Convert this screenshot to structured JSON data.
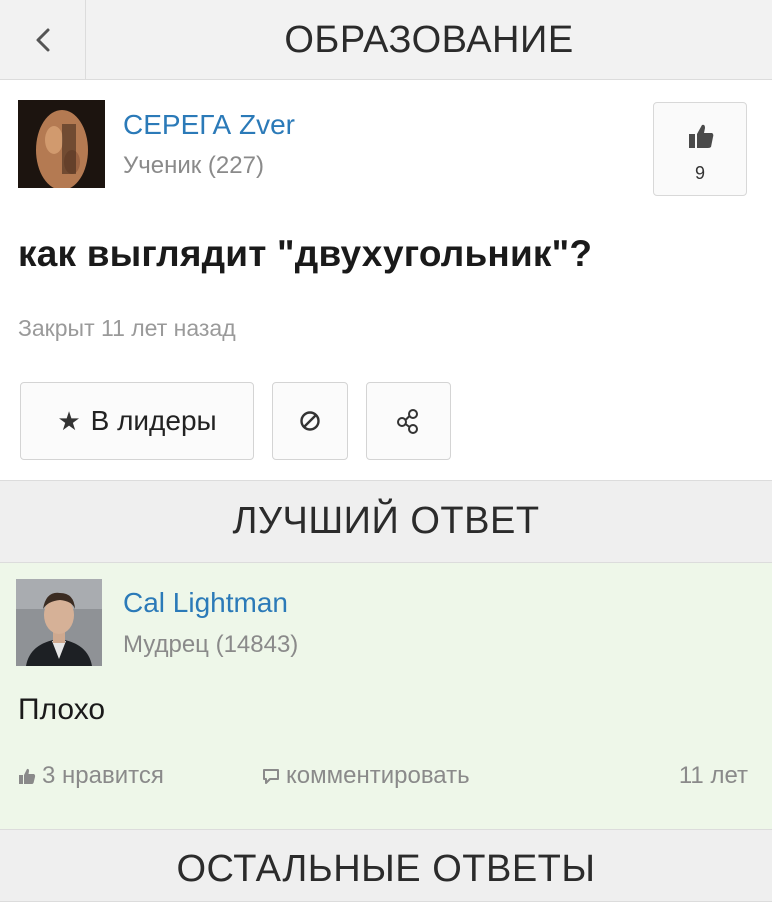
{
  "header": {
    "title": "ОБРАЗОВАНИЕ",
    "back_icon": "chevron-left-icon"
  },
  "question": {
    "author": {
      "name": "СЕРЕГА Zver",
      "rank": "Ученик (227)"
    },
    "like": {
      "icon": "thumbs-up-icon",
      "count": "9"
    },
    "title": "как выглядит \"двухугольник\"?",
    "status": "Закрыт 11 лет назад",
    "actions": {
      "leaders_icon": "star-icon",
      "leaders_label": "В лидеры",
      "report_icon": "block-icon",
      "share_icon": "share-icon"
    }
  },
  "best_answer": {
    "section_title": "ЛУЧШИЙ ОТВЕТ",
    "author": {
      "name": "Cal Lightman",
      "rank": "Мудрец (14843)"
    },
    "text": "Плохо",
    "likes_label": "3 нравится",
    "comment_label": "комментировать",
    "age": "11 лет"
  },
  "other_answers": {
    "section_title": "ОСТАЛЬНЫЕ ОТВЕТЫ"
  },
  "colors": {
    "link": "#2b7ab8",
    "best_answer_bg": "#eef7e9",
    "header_bg": "#f2f2f2"
  }
}
